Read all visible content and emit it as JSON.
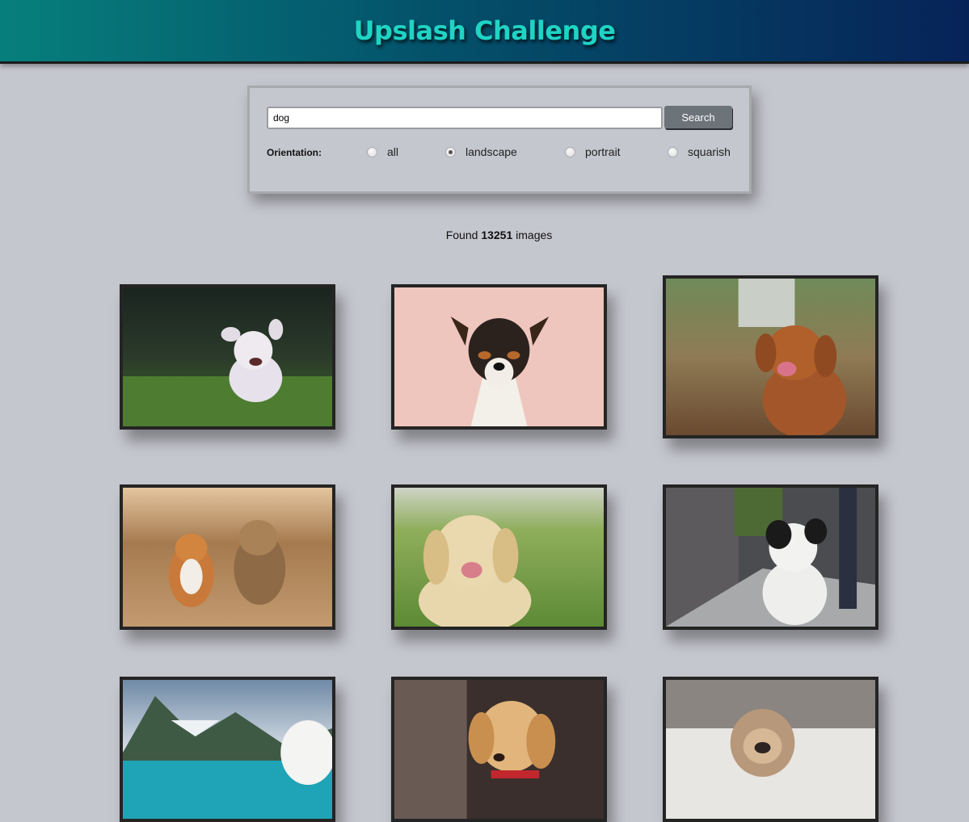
{
  "header": {
    "title": "Upslash Challenge"
  },
  "search": {
    "value": "dog",
    "placeholder": "",
    "button_label": "Search"
  },
  "orientation": {
    "label": "Orientation:",
    "options": [
      "all",
      "landscape",
      "portrait",
      "squarish"
    ],
    "selected": "landscape"
  },
  "results": {
    "prefix": "Found",
    "count": "13251",
    "suffix": "images"
  },
  "gallery": [
    {
      "subject": "white fluffy dog running on grass"
    },
    {
      "subject": "jack russell terrier on pink background"
    },
    {
      "subject": "brown retriever in tall grass"
    },
    {
      "subject": "corgi and yorkshire terrier on dirt path"
    },
    {
      "subject": "golden retriever on green lawn"
    },
    {
      "subject": "black and white dog on sidewalk"
    },
    {
      "subject": "white dog by mountain lake"
    },
    {
      "subject": "golden puppy with red collar"
    },
    {
      "subject": "pug wrapped in blanket"
    }
  ],
  "colors": {
    "background": "#c5c7ce",
    "header_start": "#067f7c",
    "header_end": "#062358",
    "title": "#1fd4c4",
    "button": "#6c7379"
  }
}
